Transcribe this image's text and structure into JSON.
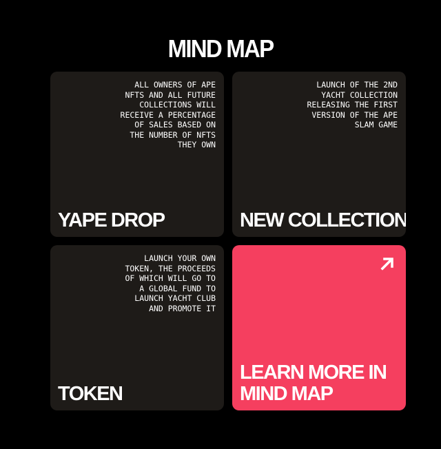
{
  "page": {
    "title": "MIND MAP"
  },
  "cards": [
    {
      "title": "YAPE DROP",
      "description": "ALL OWNERS OF APE NFTS AND ALL FUTURE COLLECTIONS WILL RECEIVE A PERCENTAGE OF SALES BASED ON THE NUMBER OF NFTS THEY OWN"
    },
    {
      "title": "NEW COLLECTION",
      "description": "LAUNCH OF THE 2ND YACHT COLLECTION RELEASING THE FIRST VERSION OF THE APE SLAM GAME"
    },
    {
      "title": "TOKEN",
      "description": "LAUNCH YOUR OWN TOKEN, THE PROCEEDS OF WHICH WILL GO TO A GLOBAL FUND TO LAUNCH YACHT CLUB AND PROMOTE IT"
    },
    {
      "title": "LEARN MORE IN MIND MAP",
      "icon": "arrow-up-right-icon"
    }
  ],
  "colors": {
    "background": "#000000",
    "card": "#1e1b18",
    "accent": "#f53f5f",
    "text": "#ffffff"
  }
}
